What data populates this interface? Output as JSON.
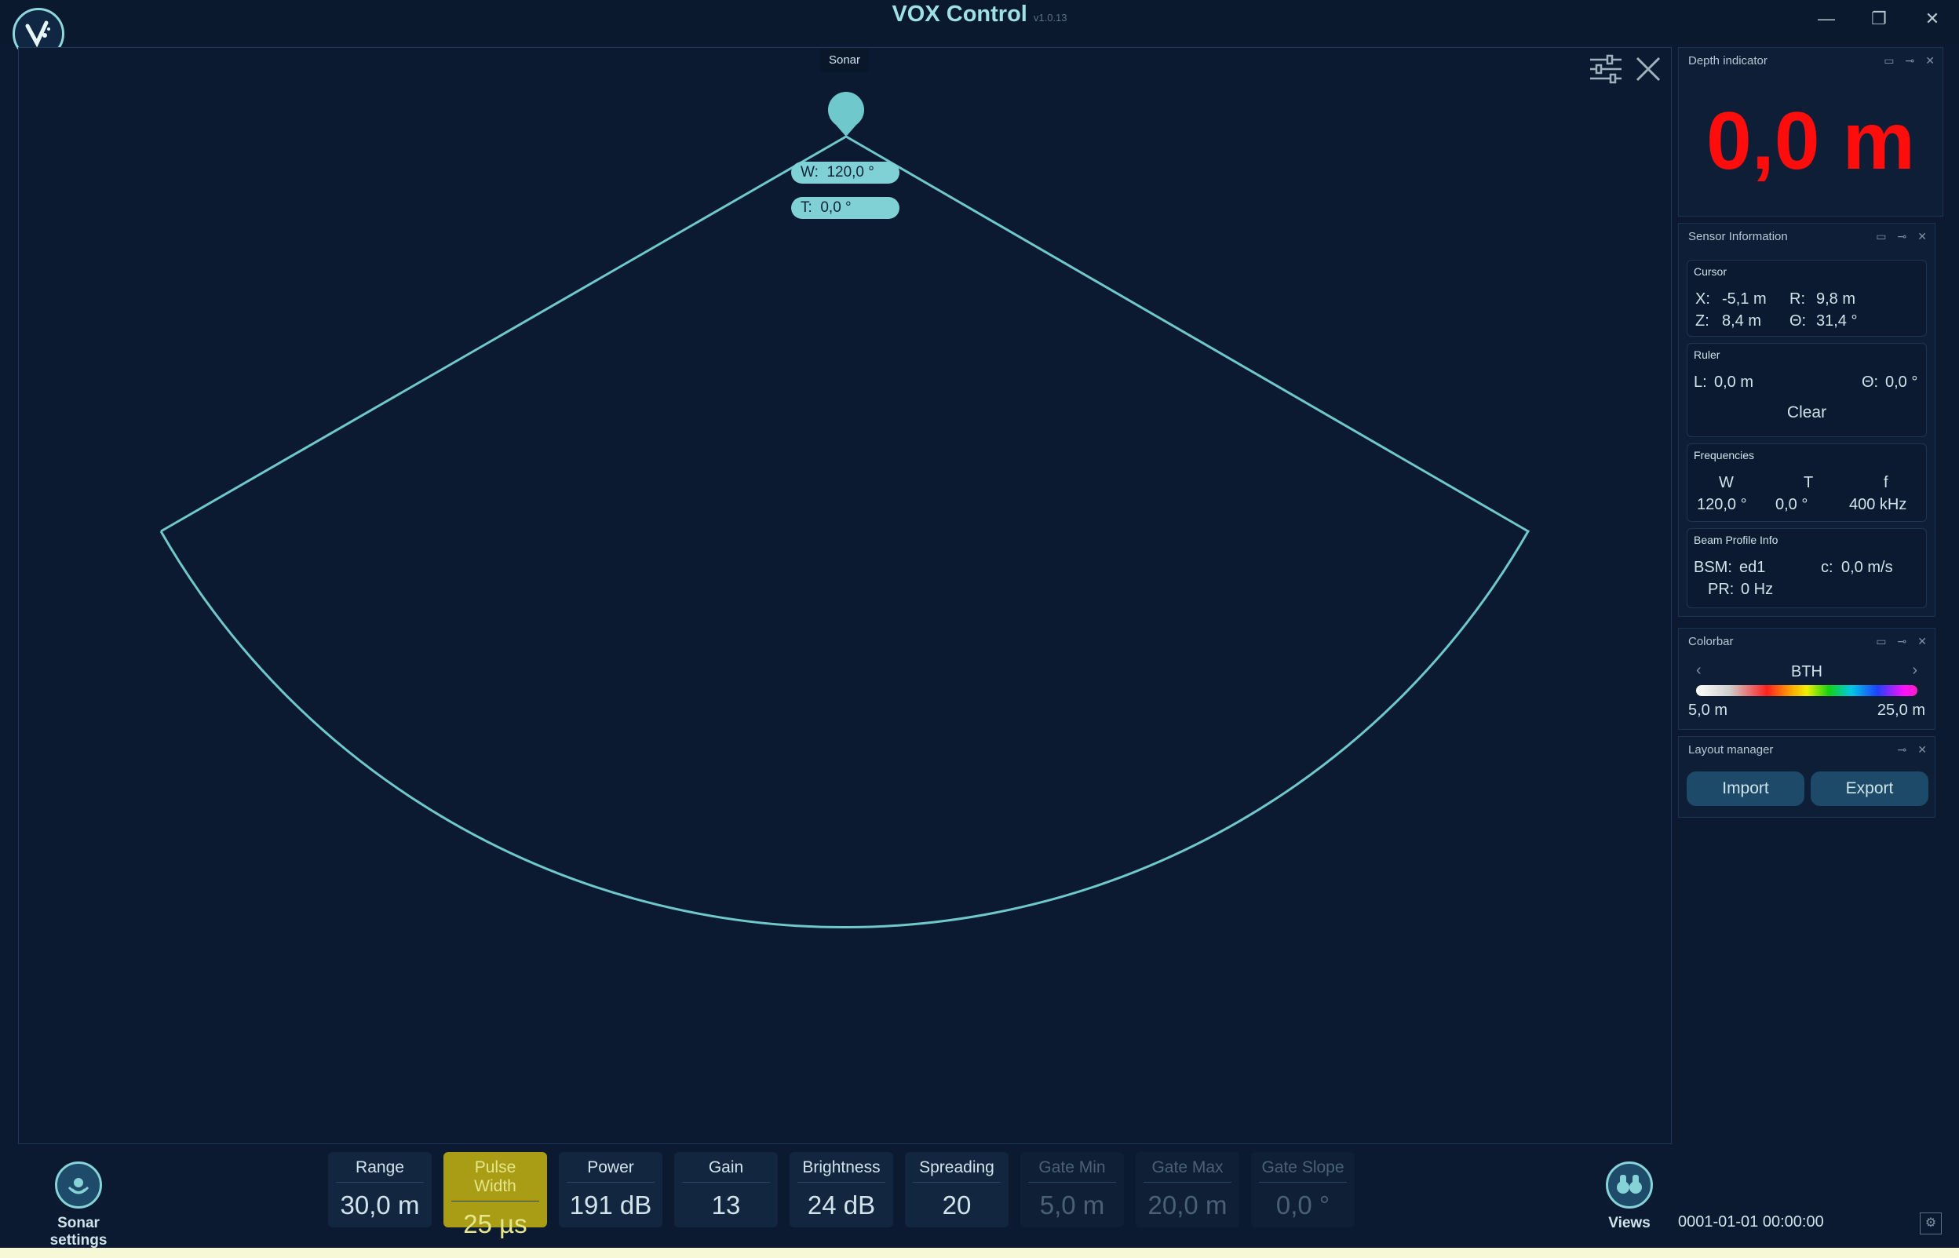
{
  "app": {
    "title": "VOX Control",
    "version": "v1.0.13"
  },
  "window": {
    "minimize": "—",
    "restore": "❐",
    "close": "✕"
  },
  "sonar": {
    "tab_label": "Sonar",
    "width_label": "W:",
    "width_value": "120,0 °",
    "tilt_label": "T:",
    "tilt_value": "0,0 °",
    "fan_color": "#6fc8cc"
  },
  "depth_indicator": {
    "title": "Depth indicator",
    "value": "0,0 m",
    "color": "#ff0d0d"
  },
  "sensor_info": {
    "title": "Sensor Information",
    "cursor": {
      "title": "Cursor",
      "x_label": "X:",
      "x": "-5,1 m",
      "r_label": "R:",
      "r": "9,8 m",
      "z_label": "Z:",
      "z": "8,4 m",
      "theta_label": "Θ:",
      "theta": "31,4 °"
    },
    "ruler": {
      "title": "Ruler",
      "l_label": "L:",
      "l": "0,0 m",
      "theta_label": "Θ:",
      "theta": "0,0 °",
      "clear": "Clear"
    },
    "frequencies": {
      "title": "Frequencies",
      "w_label": "W",
      "t_label": "T",
      "f_label": "f",
      "w": "120,0 °",
      "t": "0,0 °",
      "f": "400 kHz"
    },
    "beam_profile": {
      "title": "Beam Profile Info",
      "bsm_label": "BSM:",
      "bsm": "ed1",
      "c_label": "c:",
      "c": "0,0 m/s",
      "pr_label": "PR:",
      "pr": "0 Hz"
    }
  },
  "colorbar": {
    "title": "Colorbar",
    "name": "BTH",
    "min": "5,0 m",
    "max": "25,0 m"
  },
  "layout_manager": {
    "title": "Layout manager",
    "import": "Import",
    "export": "Export"
  },
  "bottom": {
    "sonar_settings": "Sonar settings",
    "views": "Views",
    "timestamp": "0001-01-01 00:00:00",
    "params": [
      {
        "label": "Range",
        "value": "30,0 m"
      },
      {
        "label": "Pulse Width",
        "value": "25 µs"
      },
      {
        "label": "Power",
        "value": "191 dB"
      },
      {
        "label": "Gain",
        "value": "13"
      },
      {
        "label": "Brightness",
        "value": "24 dB"
      },
      {
        "label": "Spreading",
        "value": "20"
      },
      {
        "label": "Gate Min",
        "value": "5,0 m"
      },
      {
        "label": "Gate Max",
        "value": "20,0 m"
      },
      {
        "label": "Gate Slope",
        "value": "0,0 °"
      }
    ]
  }
}
